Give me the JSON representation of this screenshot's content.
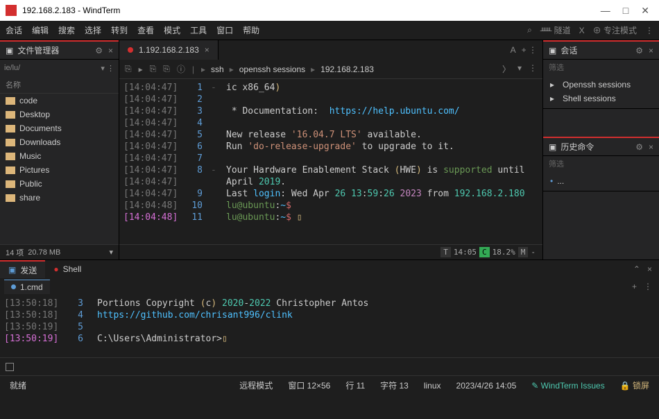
{
  "window": {
    "title": "192.168.2.183 - WindTerm"
  },
  "menus": [
    "会话",
    "编辑",
    "搜索",
    "选择",
    "转到",
    "查看",
    "模式",
    "工具",
    "窗口",
    "帮助"
  ],
  "menu_right": {
    "tunnel": "隧道",
    "x": "X",
    "focus_mode": "专注模式"
  },
  "file_mgr": {
    "title": "文件管理器",
    "crumb": "ie/lu/",
    "col": "名称",
    "items": [
      "code",
      "Desktop",
      "Documents",
      "Downloads",
      "Music",
      "Pictures",
      "Public",
      "share"
    ],
    "status_count": "14 项",
    "status_size": "20.78 MB"
  },
  "tab": {
    "label": "1.192.168.2.183"
  },
  "path": [
    "ssh",
    "openssh sessions",
    "192.168.2.183"
  ],
  "term_lines": [
    {
      "ts": "[14:04:47]",
      "n": "1",
      "bar": "-",
      "segs": [
        {
          "t": "ic x86_64",
          "c": "c-gr"
        },
        {
          "t": ")",
          "c": "c-y"
        }
      ]
    },
    {
      "ts": "[14:04:47]",
      "n": "2",
      "bar": "",
      "segs": []
    },
    {
      "ts": "[14:04:47]",
      "n": "3",
      "bar": "",
      "segs": [
        {
          "t": " * Documentation:  ",
          "c": "c-gr"
        },
        {
          "t": "https://help.ubuntu.com/",
          "c": "c-b"
        }
      ]
    },
    {
      "ts": "[14:04:47]",
      "n": "4",
      "bar": "",
      "segs": []
    },
    {
      "ts": "[14:04:47]",
      "n": "5",
      "bar": "",
      "segs": [
        {
          "t": "New release ",
          "c": "c-gr"
        },
        {
          "t": "'16.04.7 LTS'",
          "c": "c-o"
        },
        {
          "t": " available.",
          "c": "c-gr"
        }
      ]
    },
    {
      "ts": "[14:04:47]",
      "n": "6",
      "bar": "",
      "segs": [
        {
          "t": "Run ",
          "c": "c-gr"
        },
        {
          "t": "'do-release-upgrade'",
          "c": "c-o"
        },
        {
          "t": " to upgrade to it.",
          "c": "c-gr"
        }
      ]
    },
    {
      "ts": "[14:04:47]",
      "n": "7",
      "bar": "",
      "segs": []
    },
    {
      "ts": "[14:04:47]",
      "n": "8",
      "bar": "-",
      "segs": [
        {
          "t": "Your Hardware Enablement Stack ",
          "c": "c-gr"
        },
        {
          "t": "(",
          "c": "c-y"
        },
        {
          "t": "HWE",
          "c": "c-gr"
        },
        {
          "t": ")",
          "c": "c-y"
        },
        {
          "t": " is ",
          "c": "c-gr"
        },
        {
          "t": "supported",
          "c": "c-g"
        },
        {
          "t": " until ",
          "c": "c-gr"
        }
      ]
    },
    {
      "ts": "[14:04:47]",
      "n": "",
      "bar": "",
      "segs": [
        {
          "t": "April ",
          "c": "c-gr"
        },
        {
          "t": "2019",
          "c": "c-c"
        },
        {
          "t": ".",
          "c": "c-gr"
        }
      ]
    },
    {
      "ts": "[14:04:47]",
      "n": "9",
      "bar": "",
      "segs": [
        {
          "t": "Last ",
          "c": "c-gr"
        },
        {
          "t": "login",
          "c": "c-b"
        },
        {
          "t": ": Wed Apr ",
          "c": "c-gr"
        },
        {
          "t": "26 13",
          "c": "c-c"
        },
        {
          "t": ":",
          "c": "c-gr"
        },
        {
          "t": "59",
          "c": "c-c"
        },
        {
          "t": ":",
          "c": "c-gr"
        },
        {
          "t": "26 ",
          "c": "c-c"
        },
        {
          "t": "2023",
          "c": "c-p"
        },
        {
          "t": " from ",
          "c": "c-gr"
        },
        {
          "t": "192.168.2.180",
          "c": "c-c"
        }
      ]
    },
    {
      "ts": "[14:04:48]",
      "n": "10",
      "bar": "",
      "segs": [
        {
          "t": "lu@ubuntu",
          "c": "c-g"
        },
        {
          "t": ":",
          "c": "c-gr"
        },
        {
          "t": "~",
          "c": "c-b"
        },
        {
          "t": "$",
          "c": "c-br"
        }
      ]
    },
    {
      "ts_cur": "[14:04:48]",
      "n": "11",
      "bar": "",
      "segs": [
        {
          "t": "lu@ubuntu",
          "c": "c-g"
        },
        {
          "t": ":",
          "c": "c-gr"
        },
        {
          "t": "~",
          "c": "c-b"
        },
        {
          "t": "$ ",
          "c": "c-br"
        },
        {
          "t": "▯",
          "c": "c-y"
        }
      ]
    }
  ],
  "term_status": {
    "t": "T",
    "time": "14:05",
    "c": "C",
    "cpu": "18.2%",
    "m": "M",
    "mem": "-"
  },
  "sessions": {
    "title": "会话",
    "filter": "筛选",
    "items": [
      "Openssh sessions",
      "Shell sessions"
    ]
  },
  "history": {
    "title": "历史命令",
    "filter": "筛选",
    "item": "..."
  },
  "bottom_tabs": {
    "send": "发送",
    "shell": "Shell"
  },
  "shell_tab": "1.cmd",
  "shell_lines": [
    {
      "ts": "[13:50:18]",
      "n": "3",
      "segs": [
        {
          "t": "Portions Copyright ",
          "c": "c-gr"
        },
        {
          "t": "(",
          "c": "c-y"
        },
        {
          "t": "c",
          "c": "c-gr"
        },
        {
          "t": ")",
          "c": "c-y"
        },
        {
          "t": " ",
          "c": "c-gr"
        },
        {
          "t": "2020",
          "c": "c-c"
        },
        {
          "t": "-",
          "c": "c-gr"
        },
        {
          "t": "2022",
          "c": "c-c"
        },
        {
          "t": " Christopher Antos",
          "c": "c-gr"
        }
      ]
    },
    {
      "ts": "[13:50:18]",
      "n": "4",
      "segs": [
        {
          "t": "https://github.com/chrisant996/clink",
          "c": "c-b"
        }
      ]
    },
    {
      "ts": "[13:50:19]",
      "n": "5",
      "segs": []
    },
    {
      "ts_cur": "[13:50:19]",
      "n": "6",
      "segs": [
        {
          "t": "C:\\Users\\Administrator>",
          "c": "c-gr"
        },
        {
          "t": "▯",
          "c": "c-y"
        }
      ]
    }
  ],
  "status": {
    "ready": "就绪",
    "remote": "远程模式",
    "winsize": "窗口 12×56",
    "line": "行 11",
    "char": "字符 13",
    "os": "linux",
    "datetime": "2023/4/26 14:05",
    "issues": "WindTerm Issues",
    "lock": "锁屏"
  }
}
